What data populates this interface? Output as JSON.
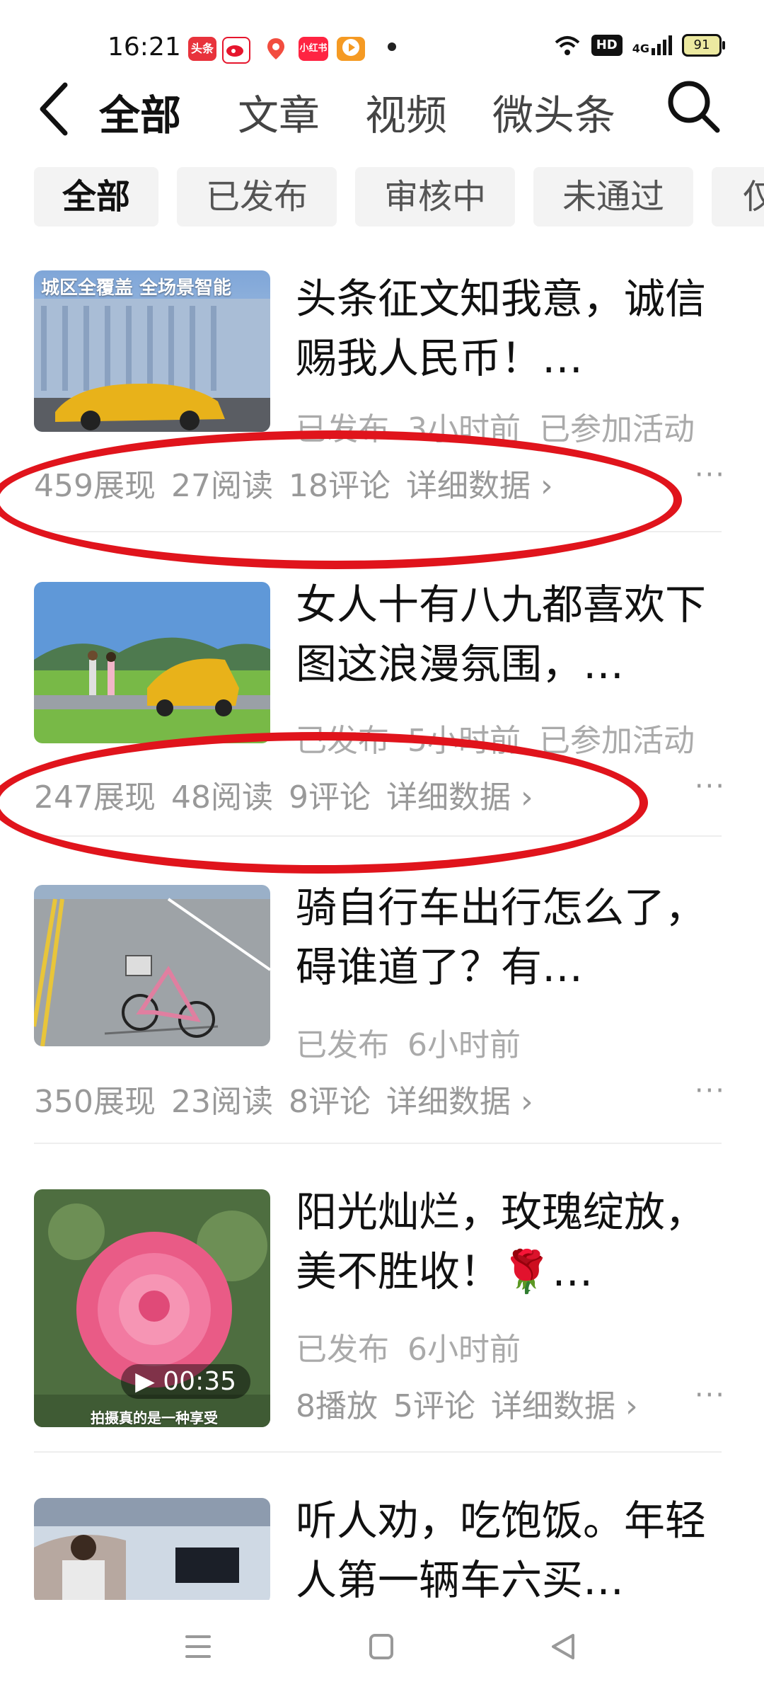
{
  "status_bar": {
    "time": "16:21",
    "notifications": [
      {
        "name": "toutiao-notif-icon",
        "label": "头条",
        "color": "#e8333c"
      },
      {
        "name": "weibo-notif-icon",
        "label": "",
        "color": "#e6162d"
      },
      {
        "name": "map-notif-icon",
        "label": "",
        "color": "#f24d3f"
      },
      {
        "name": "xiaohongshu-notif-icon",
        "label": "小红书",
        "color": "#ff2442"
      },
      {
        "name": "video-notif-icon",
        "label": "",
        "color": "#f59a23"
      }
    ],
    "hd": "HD",
    "signal": "4G",
    "battery": "91"
  },
  "top_nav": {
    "tabs": [
      {
        "label": "全部",
        "active": true
      },
      {
        "label": "文章",
        "active": false
      },
      {
        "label": "视频",
        "active": false
      },
      {
        "label": "微头条",
        "active": false
      }
    ]
  },
  "filters": [
    {
      "label": "全部",
      "active": true
    },
    {
      "label": "已发布",
      "active": false
    },
    {
      "label": "审核中",
      "active": false
    },
    {
      "label": "未通过",
      "active": false
    },
    {
      "label": "仅",
      "active": false
    }
  ],
  "items": [
    {
      "title": "头条征文知我意，诚信赐我人民币！…",
      "status": "已发布",
      "time": "3小时前",
      "activity": "已参加活动",
      "thumb_caption": "城区全覆盖 全场景智能",
      "stats": [
        "459展现",
        "27阅读",
        "18评论"
      ],
      "detail": "详细数据 ›",
      "more": "···"
    },
    {
      "title": "女人十有八九都喜欢下图这浪漫氛围，…",
      "status": "已发布",
      "time": "5小时前",
      "activity": "已参加活动",
      "stats": [
        "247展现",
        "48阅读",
        "9评论"
      ],
      "detail": "详细数据 ›",
      "more": "···"
    },
    {
      "title": "骑自行车出行怎么了，碍谁道了？有…",
      "status": "已发布",
      "time": "6小时前",
      "activity": "",
      "stats": [
        "350展现",
        "23阅读",
        "8评论"
      ],
      "detail": "详细数据 ›",
      "more": "···"
    },
    {
      "title": "阳光灿烂，玫瑰绽放，美不胜收！🌹…",
      "status": "已发布",
      "time": "6小时前",
      "activity": "",
      "duration": "▶ 00:35",
      "thumb_caption": "拍摄真的是一种享受",
      "stats": [
        "8播放",
        "5评论"
      ],
      "detail": "详细数据 ›",
      "more": "···"
    },
    {
      "title": "听人劝，吃饱饭。年轻人第一辆车六买…",
      "status": "",
      "time": "",
      "activity": "",
      "stats": [],
      "detail": "",
      "more": ""
    }
  ]
}
